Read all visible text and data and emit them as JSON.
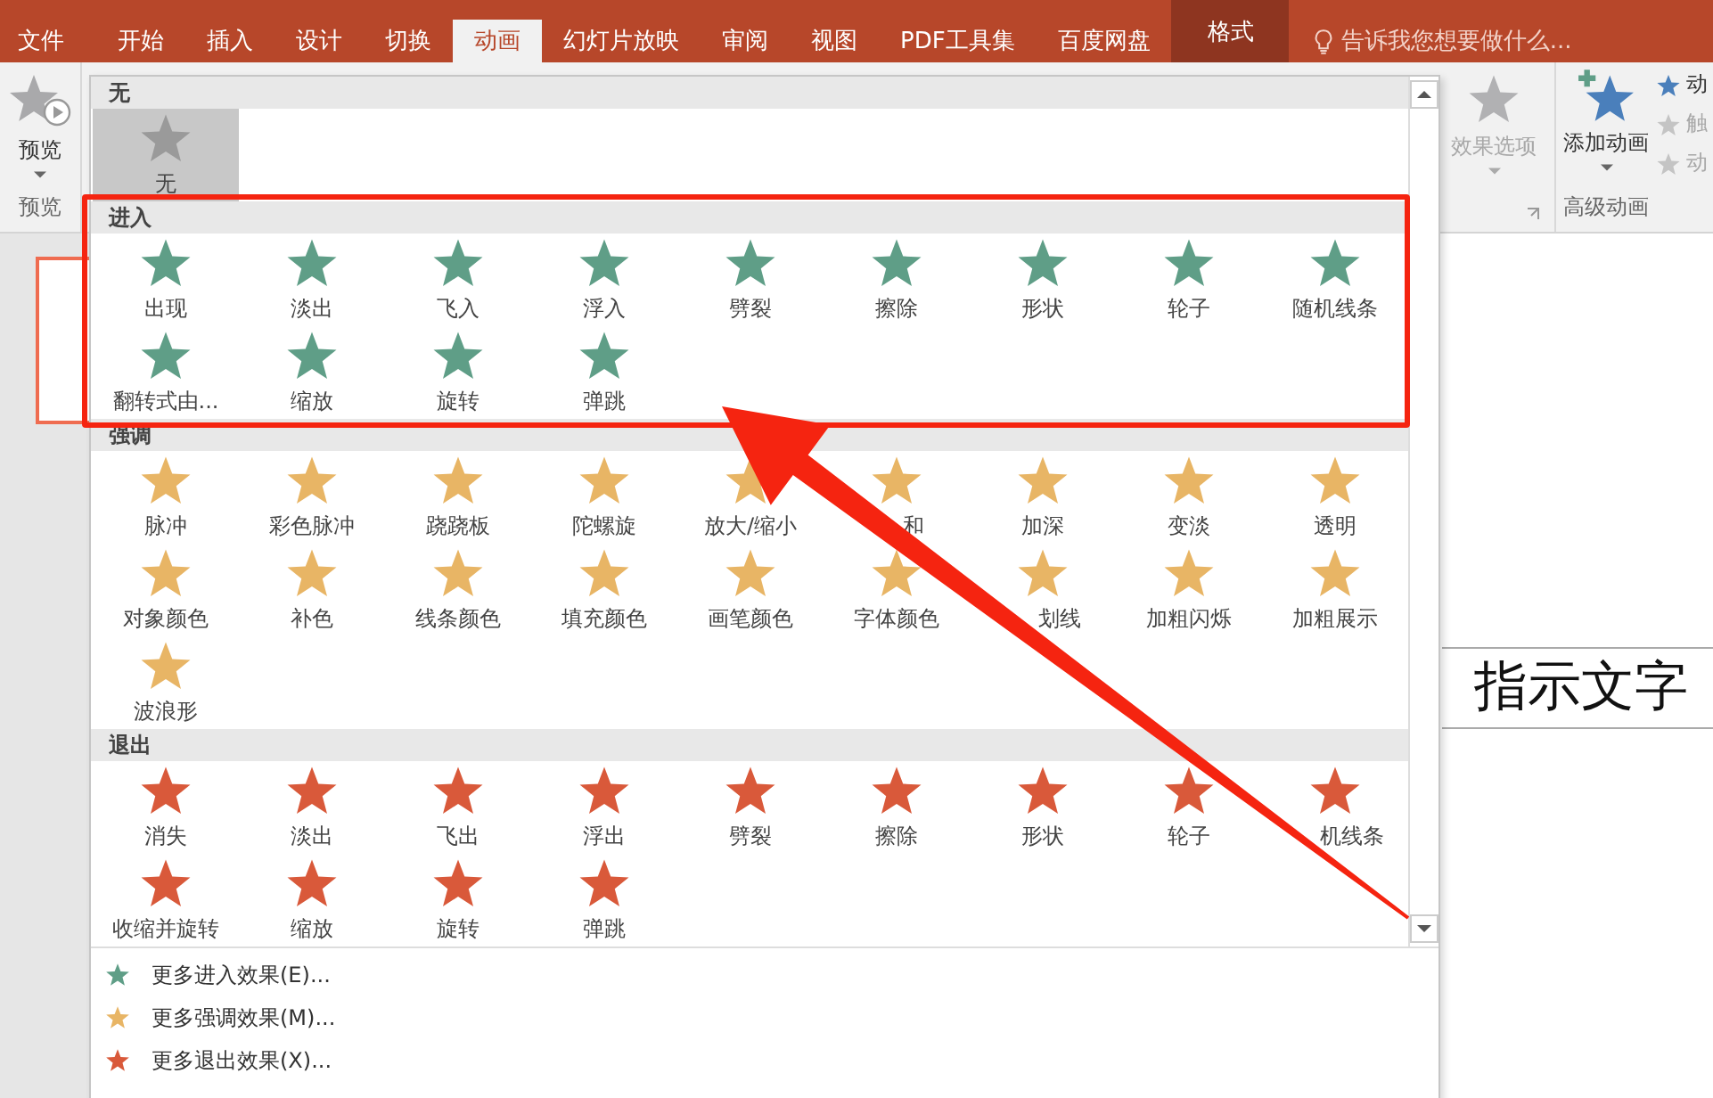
{
  "tabs": [
    {
      "label": "文件",
      "selected": false,
      "kind": "file"
    },
    {
      "label": "开始",
      "selected": false,
      "kind": "normal"
    },
    {
      "label": "插入",
      "selected": false,
      "kind": "normal"
    },
    {
      "label": "设计",
      "selected": false,
      "kind": "normal"
    },
    {
      "label": "切换",
      "selected": false,
      "kind": "normal"
    },
    {
      "label": "动画",
      "selected": true,
      "kind": "normal"
    },
    {
      "label": "幻灯片放映",
      "selected": false,
      "kind": "normal"
    },
    {
      "label": "审阅",
      "selected": false,
      "kind": "normal"
    },
    {
      "label": "视图",
      "selected": false,
      "kind": "normal"
    },
    {
      "label": "PDF工具集",
      "selected": false,
      "kind": "normal"
    },
    {
      "label": "百度网盘",
      "selected": false,
      "kind": "normal"
    },
    {
      "label": "格式",
      "selected": false,
      "kind": "context"
    }
  ],
  "tell_me": {
    "text": "告诉我您想要做什么..."
  },
  "ribbon": {
    "preview": {
      "label": "预览",
      "group": "预览"
    },
    "effect_options": {
      "label": "效果选项",
      "disabled": true
    },
    "add_animation": {
      "label": "添加动画"
    },
    "advanced_items": [
      {
        "label": "动",
        "disabled": false
      },
      {
        "label": "触",
        "disabled": true
      },
      {
        "label": "动",
        "disabled": true
      }
    ],
    "advanced_group": "高级动画"
  },
  "gallery": {
    "sections": [
      {
        "title": "无",
        "kind": "none",
        "items": [
          {
            "label": "无",
            "selected": true
          }
        ]
      },
      {
        "title": "进入",
        "kind": "entrance",
        "items": [
          {
            "label": "出现"
          },
          {
            "label": "淡出"
          },
          {
            "label": "飞入"
          },
          {
            "label": "浮入"
          },
          {
            "label": "劈裂"
          },
          {
            "label": "擦除"
          },
          {
            "label": "形状"
          },
          {
            "label": "轮子"
          },
          {
            "label": "随机线条"
          },
          {
            "label": "翻转式由..."
          },
          {
            "label": "缩放"
          },
          {
            "label": "旋转"
          },
          {
            "label": "弹跳"
          }
        ]
      },
      {
        "title": "强调",
        "kind": "emphasis",
        "items": [
          {
            "label": "脉冲"
          },
          {
            "label": "彩色脉冲"
          },
          {
            "label": "跷跷板"
          },
          {
            "label": "陀螺旋"
          },
          {
            "label": "放大/缩小"
          },
          {
            "label": "和",
            "partly_hidden": true
          },
          {
            "label": "加深"
          },
          {
            "label": "变淡"
          },
          {
            "label": "透明"
          },
          {
            "label": "对象颜色"
          },
          {
            "label": "补色"
          },
          {
            "label": "线条颜色"
          },
          {
            "label": "填充颜色"
          },
          {
            "label": "画笔颜色"
          },
          {
            "label": "字体颜色"
          },
          {
            "label": "划线",
            "partly_hidden": true
          },
          {
            "label": "加粗闪烁"
          },
          {
            "label": "加粗展示"
          },
          {
            "label": "波浪形"
          }
        ]
      },
      {
        "title": "退出",
        "kind": "exit",
        "items": [
          {
            "label": "消失"
          },
          {
            "label": "淡出"
          },
          {
            "label": "飞出"
          },
          {
            "label": "浮出"
          },
          {
            "label": "劈裂"
          },
          {
            "label": "擦除"
          },
          {
            "label": "形状"
          },
          {
            "label": "轮子"
          },
          {
            "label": "机线条",
            "partly_hidden": true
          },
          {
            "label": "收缩并旋转"
          },
          {
            "label": "缩放"
          },
          {
            "label": "旋转"
          },
          {
            "label": "弹跳"
          }
        ]
      }
    ],
    "menu": [
      {
        "label": "更多进入效果(E)...",
        "kind": "entrance"
      },
      {
        "label": "更多强调效果(M)...",
        "kind": "emphasis"
      },
      {
        "label": "更多退出效果(X)...",
        "kind": "exit"
      }
    ]
  },
  "slide_text": "指示文字",
  "annotation": {
    "highlight_box": true,
    "arrow": true
  }
}
